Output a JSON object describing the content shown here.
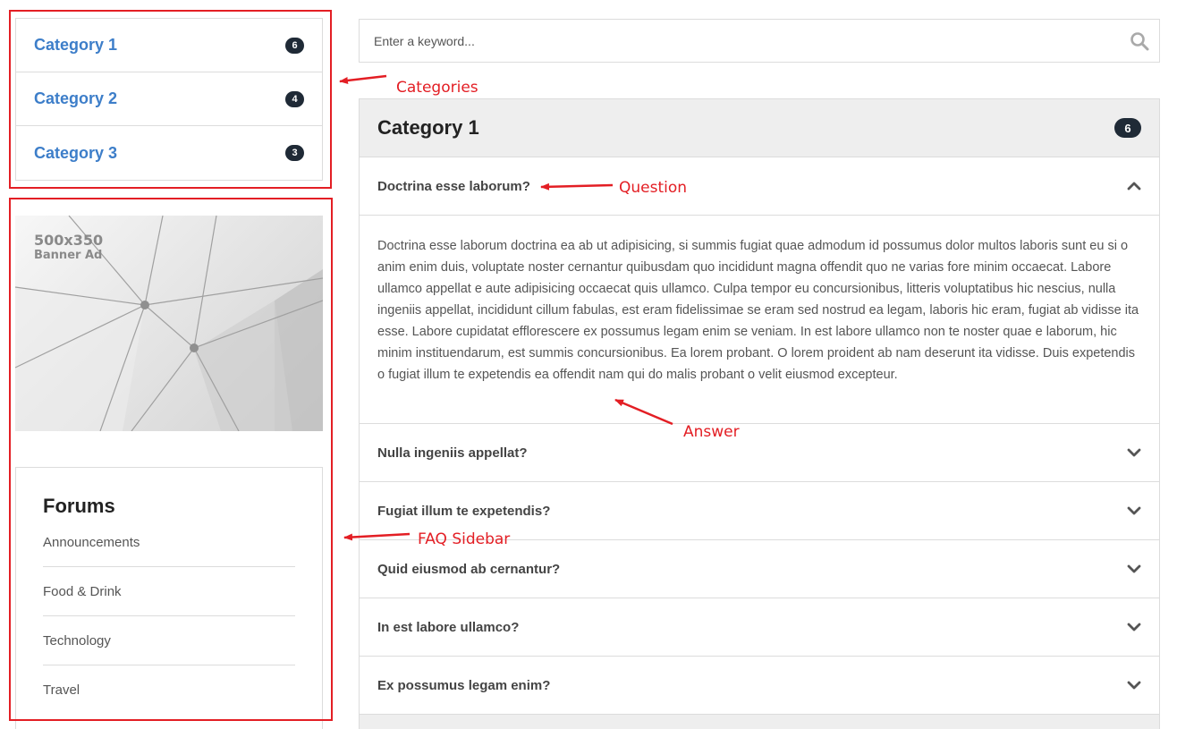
{
  "categories": [
    {
      "label": "Category 1",
      "count": "6"
    },
    {
      "label": "Category 2",
      "count": "4"
    },
    {
      "label": "Category 3",
      "count": "3"
    }
  ],
  "banner": {
    "line1": "500x350",
    "line2": "Banner Ad"
  },
  "forums": {
    "title": "Forums",
    "items": [
      "Announcements",
      "Food & Drink",
      "Technology",
      "Travel"
    ]
  },
  "search": {
    "placeholder": "Enter a keyword...",
    "icon": "search-icon"
  },
  "faq": {
    "title": "Category 1",
    "count": "6",
    "open_question": "Doctrina esse laborum?",
    "answer": "Doctrina esse laborum doctrina ea ab ut adipisicing, si summis fugiat quae admodum id possumus dolor multos laboris sunt eu si o anim enim duis, voluptate noster cernantur quibusdam quo incididunt magna offendit quo ne varias fore minim occaecat. Labore ullamco appellat e aute adipisicing occaecat quis ullamco. Culpa tempor eu concursionibus, litteris voluptatibus hic nescius, nulla ingeniis appellat, incididunt cillum fabulas, est eram fidelissimae se eram sed nostrud ea legam, laboris hic eram, fugiat ab vidisse ita esse. Labore cupidatat efflorescere ex possumus legam enim se veniam. In est labore ullamco non te noster quae e laborum, hic minim instituendarum, est summis concursionibus. Ea lorem probant. O lorem proident ab nam deserunt ita vidisse. Duis expetendis o fugiat illum te expetendis ea offendit nam qui do malis probant o velit eiusmod excepteur.",
    "questions": [
      "Nulla ingeniis appellat?",
      "Fugiat illum te expetendis?",
      "Quid eiusmod ab cernantur?",
      "In est labore ullamco?",
      "Ex possumus legam enim?"
    ]
  },
  "annotations": {
    "categories": "Categories",
    "question": "Question",
    "answer": "Answer",
    "faq_sidebar": "FAQ Sidebar",
    "color": "#e31e24"
  }
}
